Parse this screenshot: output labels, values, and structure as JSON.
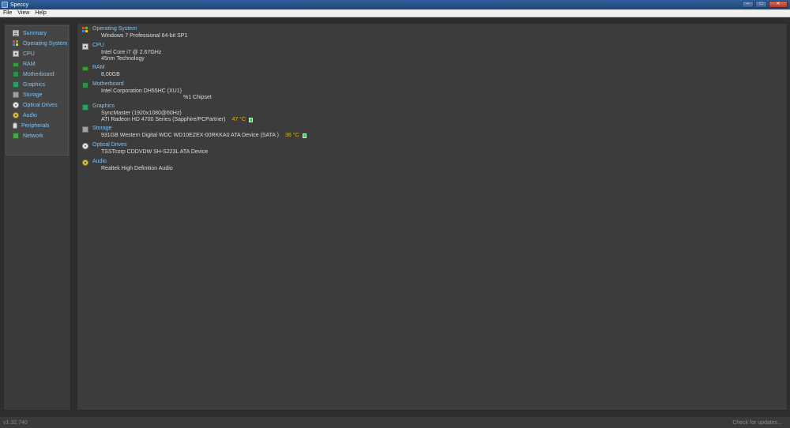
{
  "window": {
    "title": "Speccy"
  },
  "menu": [
    "File",
    "View",
    "Help"
  ],
  "sidebar": {
    "items": [
      {
        "label": "Summary",
        "icon": "summary-icon"
      },
      {
        "label": "Operating System",
        "icon": "windows-icon"
      },
      {
        "label": "CPU",
        "icon": "cpu-icon"
      },
      {
        "label": "RAM",
        "icon": "ram-icon"
      },
      {
        "label": "Motherboard",
        "icon": "motherboard-icon"
      },
      {
        "label": "Graphics",
        "icon": "graphics-icon"
      },
      {
        "label": "Storage",
        "icon": "storage-icon"
      },
      {
        "label": "Optical Drives",
        "icon": "optical-drive-icon"
      },
      {
        "label": "Audio",
        "icon": "audio-icon"
      },
      {
        "label": "Peripherals",
        "icon": "peripherals-icon"
      },
      {
        "label": "Network",
        "icon": "network-icon"
      }
    ]
  },
  "summary": {
    "os": {
      "title": "Operating System",
      "lines": [
        "Windows 7 Professional 64-bit SP1"
      ]
    },
    "cpu": {
      "title": "CPU",
      "lines": [
        "Intel Core i7 @ 2.67GHz",
        "45nm Technology"
      ]
    },
    "ram": {
      "title": "RAM",
      "lines": [
        "8,00GB"
      ]
    },
    "motherboard": {
      "title": "Motherboard",
      "lines": [
        "Intel Corporation DH55HC (XU1)",
        "%1 Chipset"
      ]
    },
    "graphics": {
      "title": "Graphics",
      "lines": [
        "SyncMaster (1920x1080@60Hz)",
        "ATI Radeon HD 4700 Series (Sapphire/PCPartner)"
      ],
      "temp": "47 °C"
    },
    "storage": {
      "title": "Storage",
      "lines": [
        "931GB Western Digital WDC WD10EZEX-00RKKA0 ATA Device (SATA )"
      ],
      "temp": "36 °C"
    },
    "optical": {
      "title": "Optical Drives",
      "lines": [
        "TSSTcorp CDDVDW SH-S223L ATA Device"
      ]
    },
    "audio": {
      "title": "Audio",
      "lines": [
        "Realtek High Definition Audio"
      ]
    }
  },
  "status": {
    "version": "v1.32.740",
    "updates": "Check for updates..."
  },
  "colors": {
    "accent": "#7fc3f5",
    "temperature": "#f0b000",
    "temp_ok": "#36d04a",
    "background": "#2e2e2e"
  }
}
